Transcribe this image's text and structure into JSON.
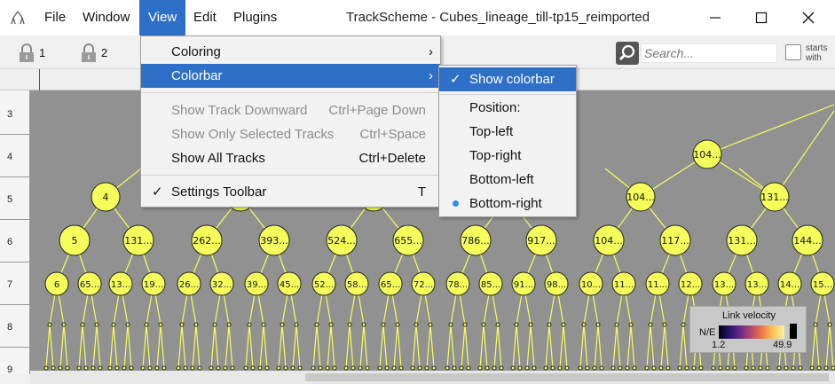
{
  "menubar": {
    "items": [
      {
        "label": "File"
      },
      {
        "label": "Window"
      },
      {
        "label": "View"
      },
      {
        "label": "Edit"
      },
      {
        "label": "Plugins"
      }
    ],
    "active": "View"
  },
  "window": {
    "title": "TrackScheme - Cubes_lineage_till-tp15_reimported",
    "controls": [
      "minimize-icon",
      "maximize-icon",
      "close-icon"
    ]
  },
  "toolbar": {
    "lock1_label": "1",
    "lock2_label": "2",
    "search_placeholder": "Search...",
    "starts_with_line1": "starts",
    "starts_with_line2": "with"
  },
  "rows": [
    "3",
    "4",
    "5",
    "6",
    "7",
    "8",
    "9"
  ],
  "view_menu": {
    "items": [
      {
        "label": "Coloring",
        "submenu": true
      },
      {
        "label": "Colorbar",
        "submenu": true,
        "selected": true
      },
      {
        "label": "Show Track Downward",
        "shortcut": "Ctrl+Page Down",
        "disabled": true
      },
      {
        "label": "Show Only Selected Tracks",
        "shortcut": "Ctrl+Space",
        "disabled": true
      },
      {
        "label": "Show All Tracks",
        "shortcut": "Ctrl+Delete"
      },
      {
        "label": "Settings Toolbar",
        "shortcut": "T",
        "checked": true
      }
    ]
  },
  "colorbar_menu": {
    "items": [
      {
        "label": "Show colorbar",
        "checked": true,
        "selected": true
      },
      {
        "label": "Position:"
      },
      {
        "label": "Top-left"
      },
      {
        "label": "Top-right"
      },
      {
        "label": "Bottom-left"
      },
      {
        "label": "Bottom-right",
        "radio": true
      }
    ]
  },
  "colorbar": {
    "title": "Link velocity",
    "nan_label": "N/E",
    "min": "1.2",
    "max": "49.9"
  },
  "graph": {
    "node_color": "#f5ff5a",
    "edge_color": "#f5ff5a",
    "row4": [
      "104..."
    ],
    "row5": [
      "4",
      "104...",
      "131..."
    ],
    "row6": [
      "5",
      "131...",
      "262...",
      "393...",
      "524...",
      "655...",
      "786...",
      "917...",
      "104...",
      "117...",
      "131...",
      "144..."
    ],
    "row7": [
      "6",
      "65...",
      "13...",
      "19...",
      "26...",
      "32...",
      "39...",
      "45...",
      "52...",
      "58...",
      "65...",
      "72...",
      "78...",
      "85...",
      "91...",
      "98...",
      "10...",
      "11...",
      "11...",
      "12...",
      "13...",
      "13...",
      "14...",
      "15..."
    ]
  }
}
